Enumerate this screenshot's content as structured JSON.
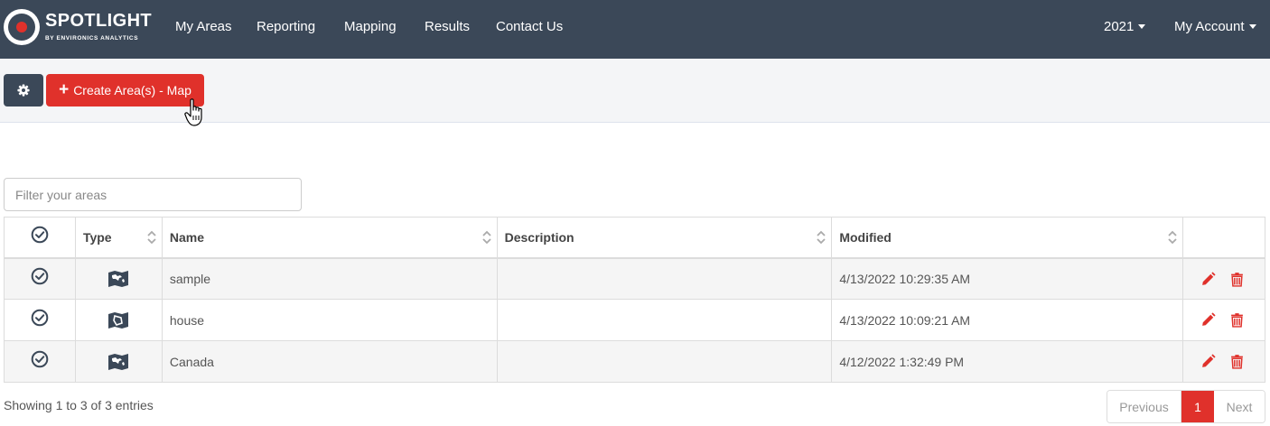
{
  "navbar": {
    "brand": "SPOTLIGHT",
    "brand_sub": "BY ENVIRONICS ANALYTICS",
    "links": [
      "My Areas",
      "Reporting",
      "Mapping",
      "Results",
      "Contact Us"
    ],
    "year": "2021",
    "account": "My Account"
  },
  "toolbar": {
    "create_label": "Create Area(s) - Map"
  },
  "filter": {
    "placeholder": "Filter your areas",
    "value": ""
  },
  "table": {
    "columns": [
      "Type",
      "Name",
      "Description",
      "Modified"
    ],
    "rows": [
      {
        "name": "sample",
        "description": "",
        "modified": "4/13/2022 10:29:35 AM",
        "type_icon": "map-icon"
      },
      {
        "name": "house",
        "description": "",
        "modified": "4/13/2022 10:09:21 AM",
        "type_icon": "polygon-map-icon"
      },
      {
        "name": "Canada",
        "description": "",
        "modified": "4/12/2022 1:32:49 PM",
        "type_icon": "map-icon"
      }
    ]
  },
  "footer": {
    "showing": "Showing 1 to 3 of 3 entries",
    "pagination": {
      "previous": "Previous",
      "current": "1",
      "next": "Next"
    }
  },
  "colors": {
    "navbar": "#3b4858",
    "accent": "#e0312b",
    "toolbar_bg": "#f4f5f7"
  }
}
